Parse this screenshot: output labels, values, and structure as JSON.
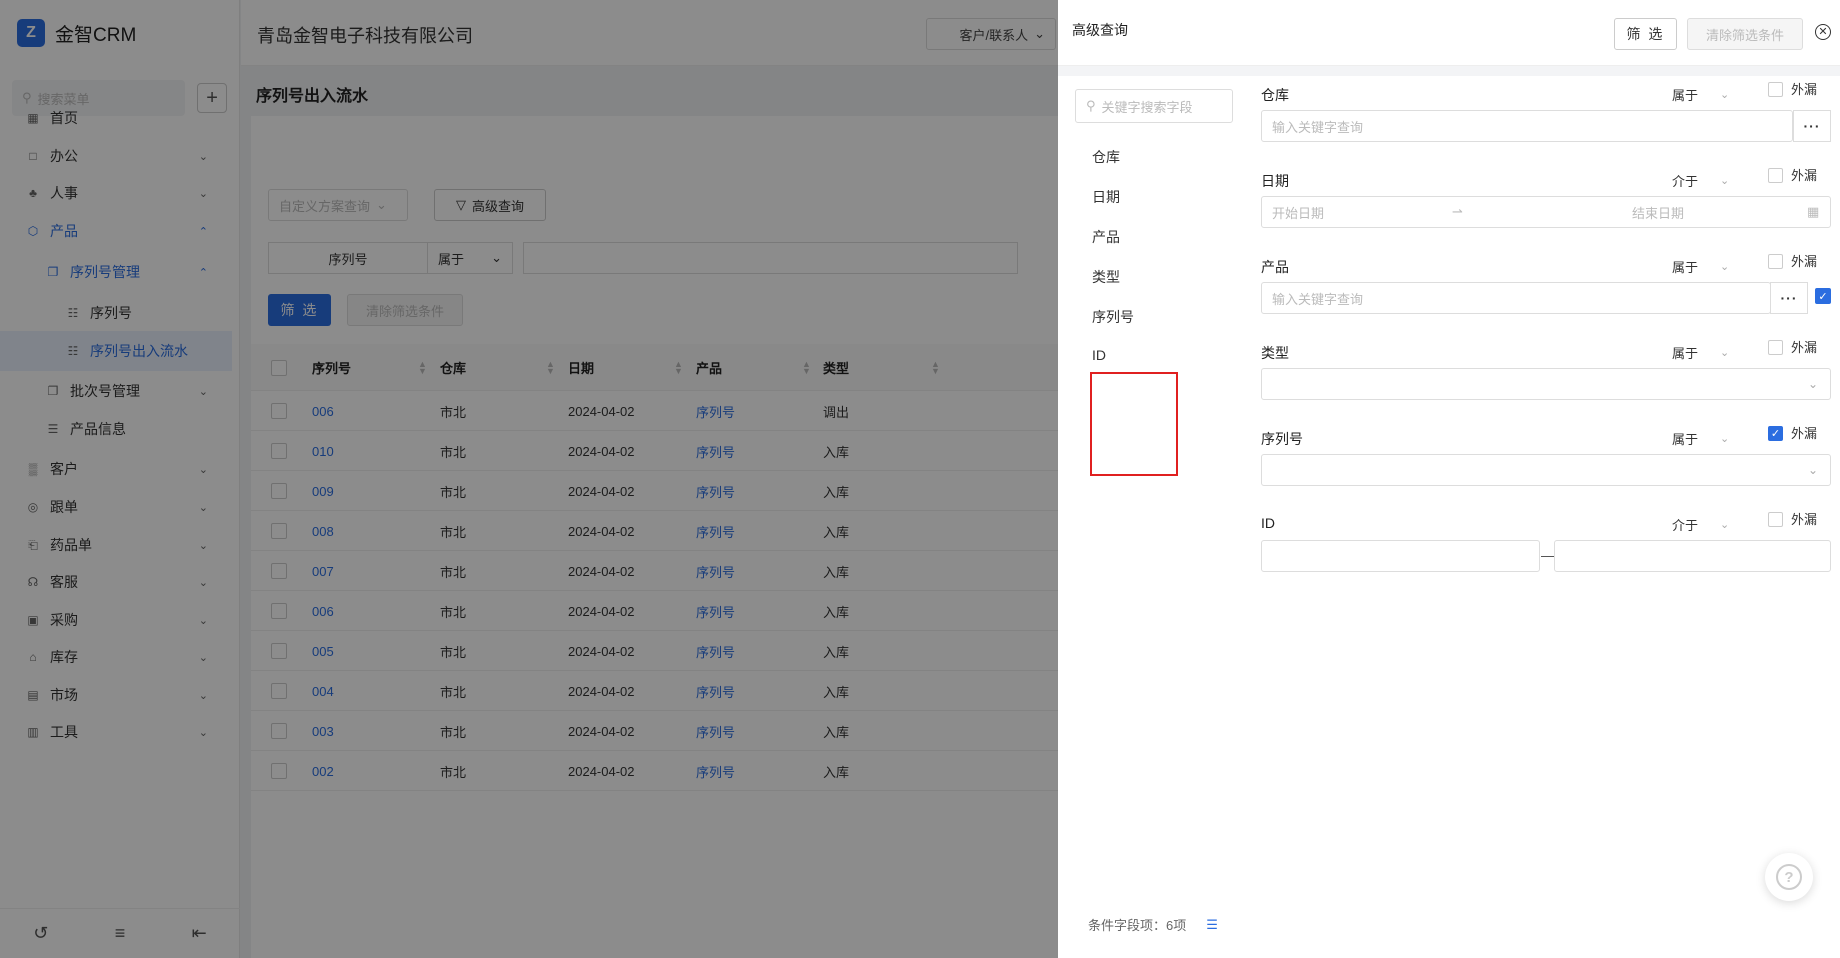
{
  "app": {
    "logo_text": "金智CRM",
    "logo_icon": "brand-icon",
    "company": "青岛金智电子科技有限公司",
    "top_select": "客户/联系人"
  },
  "sidebar": {
    "search_placeholder": "搜索菜单",
    "items": [
      {
        "label": "首页",
        "icon": "home-icon"
      },
      {
        "label": "办公",
        "icon": "office-icon"
      },
      {
        "label": "人事",
        "icon": "people-icon"
      },
      {
        "label": "产品",
        "icon": "product-icon"
      },
      {
        "label": "序列号管理",
        "icon": "copy-icon"
      },
      {
        "label": "序列号",
        "icon": "serial-icon"
      },
      {
        "label": "序列号出入流水",
        "icon": "serial-icon"
      },
      {
        "label": "批次号管理",
        "icon": "copy-icon"
      },
      {
        "label": "产品信息",
        "icon": "doc-icon"
      },
      {
        "label": "客户",
        "icon": "customer-icon"
      },
      {
        "label": "跟单",
        "icon": "follow-icon"
      },
      {
        "label": "药品单",
        "icon": "medicine-icon"
      },
      {
        "label": "客服",
        "icon": "headset-icon"
      },
      {
        "label": "采购",
        "icon": "purchase-icon"
      },
      {
        "label": "库存",
        "icon": "warehouse-icon"
      },
      {
        "label": "市场",
        "icon": "market-icon"
      },
      {
        "label": "工具",
        "icon": "toolbox-icon"
      }
    ]
  },
  "page": {
    "title": "序列号出入流水",
    "scheme_placeholder": "自定义方案查询",
    "advanced_query": "高级查询",
    "cond_field": "序列号",
    "cond_op": "属于",
    "filter_label": "筛 选",
    "clear_label": "清除筛选条件"
  },
  "table": {
    "headers": [
      "序列号",
      "仓库",
      "日期",
      "产品",
      "类型"
    ],
    "rows": [
      {
        "serial": "006",
        "warehouse": "市北",
        "date": "2024-04-02",
        "product": "序列号",
        "type": "调出"
      },
      {
        "serial": "010",
        "warehouse": "市北",
        "date": "2024-04-02",
        "product": "序列号",
        "type": "入库"
      },
      {
        "serial": "009",
        "warehouse": "市北",
        "date": "2024-04-02",
        "product": "序列号",
        "type": "入库"
      },
      {
        "serial": "008",
        "warehouse": "市北",
        "date": "2024-04-02",
        "product": "序列号",
        "type": "入库"
      },
      {
        "serial": "007",
        "warehouse": "市北",
        "date": "2024-04-02",
        "product": "序列号",
        "type": "入库"
      },
      {
        "serial": "006",
        "warehouse": "市北",
        "date": "2024-04-02",
        "product": "序列号",
        "type": "入库"
      },
      {
        "serial": "005",
        "warehouse": "市北",
        "date": "2024-04-02",
        "product": "序列号",
        "type": "入库"
      },
      {
        "serial": "004",
        "warehouse": "市北",
        "date": "2024-04-02",
        "product": "序列号",
        "type": "入库"
      },
      {
        "serial": "003",
        "warehouse": "市北",
        "date": "2024-04-02",
        "product": "序列号",
        "type": "入库"
      },
      {
        "serial": "002",
        "warehouse": "市北",
        "date": "2024-04-02",
        "product": "序列号",
        "type": "入库"
      }
    ]
  },
  "drawer": {
    "title": "高级查询",
    "filter_label": "筛 选",
    "clear_label": "清除筛选条件",
    "field_search_placeholder": "关键字搜索字段",
    "fields": [
      "仓库",
      "日期",
      "产品",
      "类型",
      "序列号",
      "ID"
    ],
    "footer": "条件字段项：6项",
    "miss_label": "外漏",
    "conditions": [
      {
        "label": "仓库",
        "op": "属于",
        "placeholder": "输入关键字查询",
        "miss": false
      },
      {
        "label": "日期",
        "op": "介于",
        "start_placeholder": "开始日期",
        "end_placeholder": "结束日期",
        "miss": false
      },
      {
        "label": "产品",
        "op": "属于",
        "placeholder": "输入关键字查询",
        "miss": false,
        "extra_checked": true
      },
      {
        "label": "类型",
        "op": "属于",
        "miss": false
      },
      {
        "label": "序列号",
        "op": "属于",
        "miss": true
      },
      {
        "label": "ID",
        "op": "介于",
        "miss": false
      }
    ]
  },
  "colors": {
    "primary": "#2b6de0",
    "highlight_box": "#e02020"
  }
}
